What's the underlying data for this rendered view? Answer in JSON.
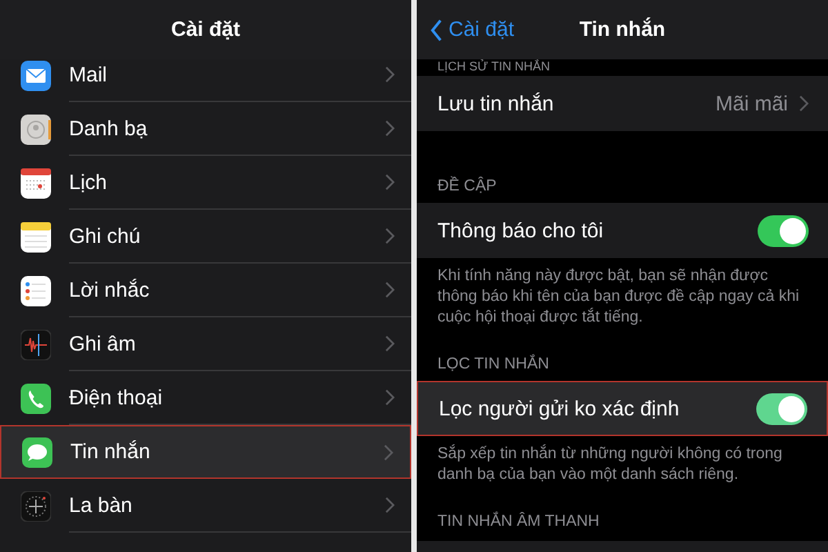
{
  "left": {
    "title": "Cài đặt",
    "items": [
      {
        "label": "Mail",
        "selected": false
      },
      {
        "label": "Danh bạ",
        "selected": false
      },
      {
        "label": "Lịch",
        "selected": false
      },
      {
        "label": "Ghi chú",
        "selected": false
      },
      {
        "label": "Lời nhắc",
        "selected": false
      },
      {
        "label": "Ghi âm",
        "selected": false
      },
      {
        "label": "Điện thoại",
        "selected": false
      },
      {
        "label": "Tin nhắn",
        "selected": true
      },
      {
        "label": "La bàn",
        "selected": false
      }
    ]
  },
  "right": {
    "back": "Cài đặt",
    "title": "Tin nhắn",
    "sections": [
      {
        "header": "LỊCH SỬ TIN NHẮN",
        "rows": [
          {
            "kind": "disclosure",
            "label": "Lưu tin nhắn",
            "value": "Mãi mãi",
            "highlighted": false
          }
        ]
      },
      {
        "header": "ĐỀ CẬP",
        "rows": [
          {
            "kind": "toggle",
            "label": "Thông báo cho tôi",
            "on": true,
            "highlighted": false
          }
        ],
        "footer": "Khi tính năng này được bật, bạn sẽ nhận được thông báo khi tên của bạn được đề cập ngay cả khi cuộc hội thoại được tắt tiếng."
      },
      {
        "header": "LỌC TIN NHẮN",
        "rows": [
          {
            "kind": "toggle",
            "label": "Lọc người gửi ko xác định",
            "on": true,
            "highlighted": true
          }
        ],
        "footer": "Sắp xếp tin nhắn từ những người không có trong danh bạ của bạn vào một danh sách riêng."
      },
      {
        "header": "TIN NHẮN ÂM THANH"
      }
    ]
  }
}
